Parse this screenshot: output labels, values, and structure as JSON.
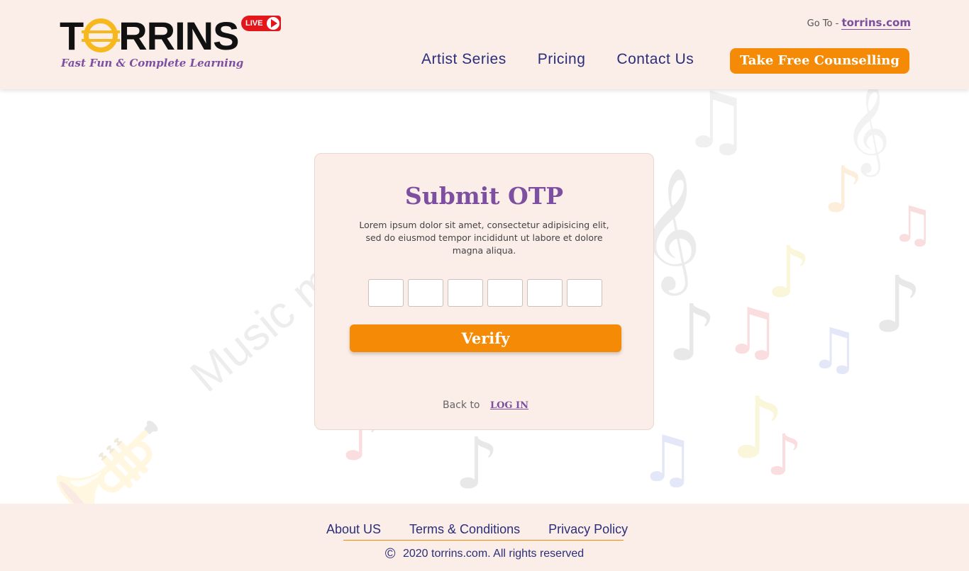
{
  "header": {
    "logo_text": "TORRINS",
    "logo_tagline": "Fast Fun & Complete Learning",
    "live_label": "LIVE",
    "goto_prefix": "Go To -",
    "goto_link": "torrins.com",
    "nav": [
      {
        "label": "Artist Series"
      },
      {
        "label": "Pricing"
      },
      {
        "label": "Contact Us"
      }
    ],
    "cta_label": "Take Free Counselling"
  },
  "decor": {
    "watermark_text": "Music m"
  },
  "otp_card": {
    "title": "Submit OTP",
    "description": "Lorem ipsum dolor sit amet, consectetur adipisicing elit, sed do eiusmod tempor incididunt ut labore et dolore magna aliqua.",
    "otp_digits": [
      "",
      "",
      "",
      "",
      "",
      ""
    ],
    "verify_label": "Verify",
    "back_text": "Back to",
    "login_link": "LOG IN"
  },
  "footer": {
    "links": [
      {
        "label": "About US"
      },
      {
        "label": "Terms & Conditions"
      },
      {
        "label": "Privacy Policy"
      }
    ],
    "copyright_symbol": "©",
    "copyright": "2020 torrins.com. All rights reserved"
  },
  "colors": {
    "accent_orange": "#f58a07",
    "brand_purple": "#7d4fa1",
    "nav_blue": "#2b2f7a",
    "panel_bg": "#fbede7"
  }
}
